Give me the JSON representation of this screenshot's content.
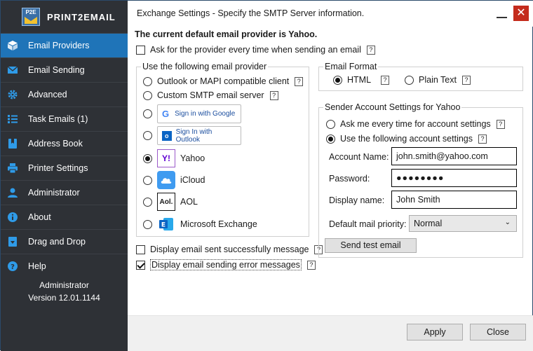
{
  "app": {
    "logo_abbr": "P2E",
    "logo_text": "PRINT2EMAIL"
  },
  "sidebar": {
    "items": [
      {
        "label": "Email Providers",
        "icon": "box-icon"
      },
      {
        "label": "Email Sending",
        "icon": "envelope-icon"
      },
      {
        "label": "Advanced",
        "icon": "gear-icon"
      },
      {
        "label": "Task Emails (1)",
        "icon": "tasks-icon"
      },
      {
        "label": "Address Book",
        "icon": "bookmark-icon"
      },
      {
        "label": "Printer Settings",
        "icon": "printer-icon"
      },
      {
        "label": "Administrator",
        "icon": "user-icon"
      },
      {
        "label": "About",
        "icon": "info-icon"
      },
      {
        "label": "Drag and Drop",
        "icon": "drag-drop-icon"
      },
      {
        "label": "Help",
        "icon": "help-icon"
      }
    ],
    "footer_user": "Administrator",
    "footer_version": "Version 12.01.1144"
  },
  "window": {
    "title": "Exchange Settings - Specify the SMTP Server information."
  },
  "main": {
    "headline": "The current default email provider is Yahoo.",
    "ask_provider_label": "Ask for the provider every time when sending an email",
    "ask_provider_checked": false,
    "provider_group": {
      "legend": "Use the following email provider",
      "outlook_mapi": "Outlook or MAPI compatible client",
      "custom_smtp": "Custom SMTP email server",
      "google_button": "Sign in with Google",
      "outlook_button": "Sign In with Outlook",
      "yahoo": "Yahoo",
      "icloud": "iCloud",
      "aol": "AOL",
      "aol_logo": "Aol.",
      "exchange": "Microsoft Exchange",
      "selected": "yahoo"
    },
    "display_success_label": "Display email sent successfully message",
    "display_success_checked": false,
    "display_error_label": "Display email sending error messages",
    "display_error_checked": true,
    "format_group": {
      "legend": "Email Format",
      "html": "HTML",
      "plain": "Plain Text",
      "selected": "html"
    },
    "sender_group": {
      "legend": "Sender Account Settings for Yahoo",
      "ask_every_time": "Ask me every time for account settings",
      "use_following": "Use the following account settings",
      "selected": "use_following",
      "account_name_label": "Account Name:",
      "account_name_value": "john.smith@yahoo.com",
      "password_label": "Password:",
      "password_value": "●●●●●●●●",
      "display_name_label": "Display name:",
      "display_name_value": "John Smith",
      "priority_label": "Default mail priority:",
      "priority_value": "Normal",
      "send_test_button": "Send test email"
    }
  },
  "footer": {
    "apply": "Apply",
    "close": "Close"
  },
  "help_glyph": "?"
}
